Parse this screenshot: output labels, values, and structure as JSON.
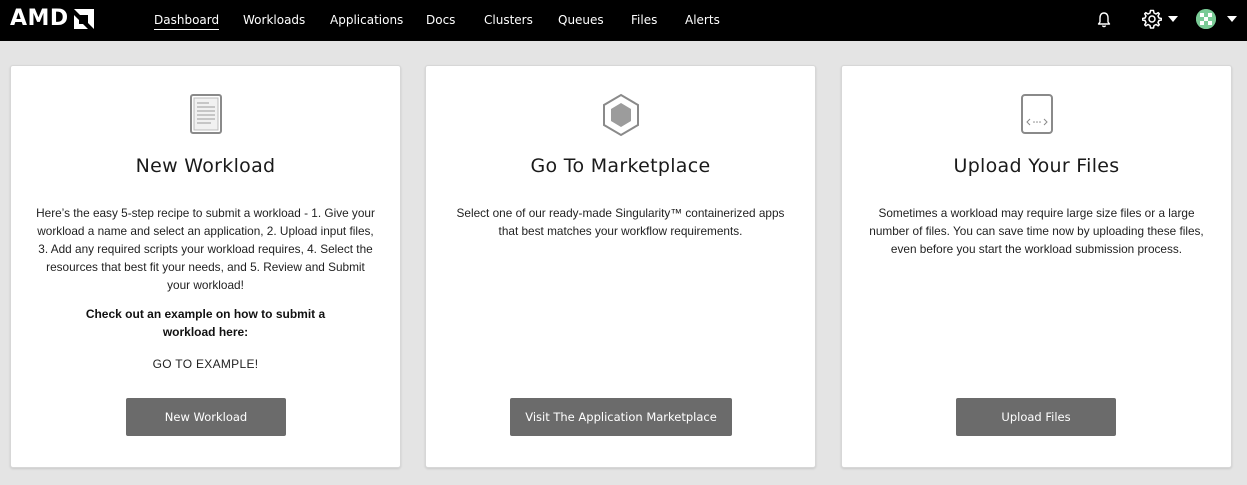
{
  "brand": {
    "name": "AMD"
  },
  "nav": {
    "items": [
      {
        "label": "Dashboard",
        "active": true
      },
      {
        "label": "Workloads"
      },
      {
        "label": "Applications"
      },
      {
        "label": "Docs"
      },
      {
        "label": "Clusters"
      },
      {
        "label": "Queues"
      },
      {
        "label": "Files"
      },
      {
        "label": "Alerts"
      }
    ]
  },
  "header_icons": [
    "bell-icon",
    "gear-icon",
    "chevron-down-icon",
    "avatar"
  ],
  "cards": [
    {
      "icon": "document-icon",
      "title": "New Workload",
      "description": "Here’s the easy 5-step recipe to submit a workload - 1. Give your workload a name and select an application, 2. Upload input files, 3. Add any required scripts your workload requires, 4. Select the resources that best fit your needs, and 5. Review and Submit your workload!",
      "emphasis": "Check out an example on how to submit a workload here:",
      "link": "GO TO EXAMPLE!",
      "button": "New Workload"
    },
    {
      "icon": "hexagon-icon",
      "title": "Go To Marketplace",
      "description": "Select one of our ready-made Singularity™ containerized apps that best matches your workflow requirements.",
      "button": "Visit The Application Marketplace"
    },
    {
      "icon": "code-file-icon",
      "title": "Upload Your Files",
      "description": "Sometimes a workload may require large size files or a large number of files. You can save time now by uploading these files, even before you start the workload submission process.",
      "button": "Upload Files"
    }
  ],
  "colors": {
    "topbar": "#000000",
    "page_bg": "#e4e4e4",
    "button": "#6b6b6b",
    "avatar": "#6cc08b"
  }
}
